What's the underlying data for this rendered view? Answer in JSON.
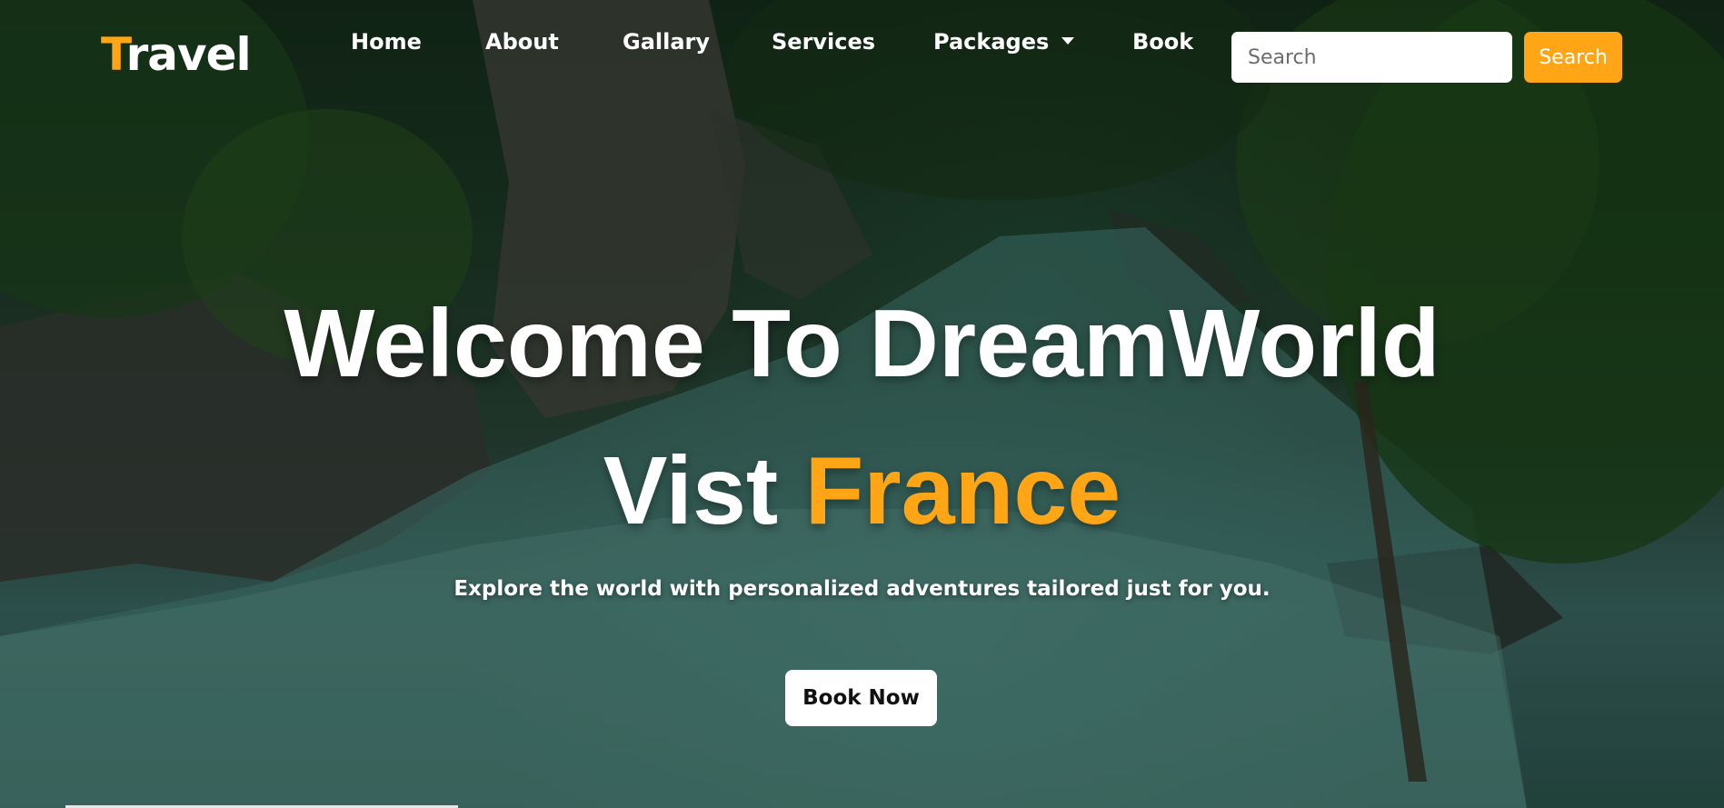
{
  "brand": {
    "first_letter": "T",
    "rest": "ravel"
  },
  "nav": {
    "items": [
      {
        "label": "Home"
      },
      {
        "label": "About"
      },
      {
        "label": "Gallary"
      },
      {
        "label": "Services"
      },
      {
        "label": "Packages"
      },
      {
        "label": "Book"
      }
    ],
    "packages_has_dropdown": true
  },
  "search": {
    "placeholder": "Search",
    "button_label": "Search"
  },
  "hero": {
    "headline": "Welcome To DreamWorld",
    "subline_prefix": "Vist ",
    "subline_highlight": "France",
    "tagline": "Explore the world with personalized adventures tailored just for you.",
    "cta_label": "Book Now"
  },
  "colors": {
    "accent": "#ffa516",
    "text": "#ffffff",
    "button_bg": "#ffffff"
  },
  "icons": {
    "dropdown": "caret-down-icon"
  }
}
